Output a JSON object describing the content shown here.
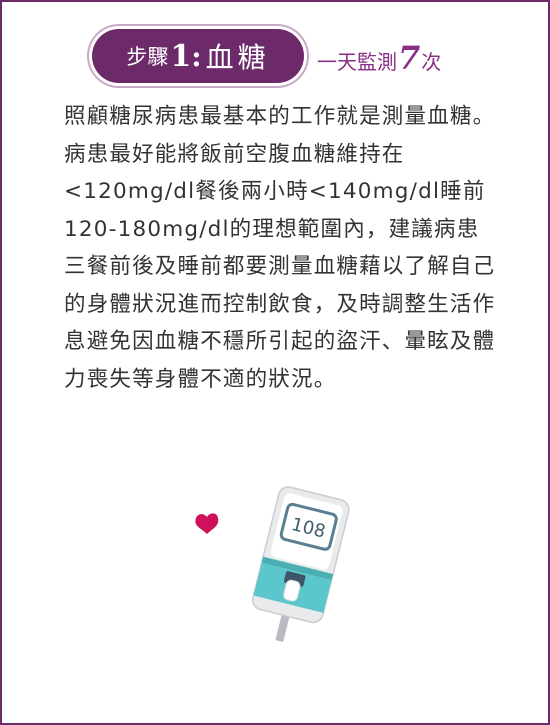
{
  "step": {
    "prefix": "步驟",
    "number": "1",
    "colon": ":",
    "title": "血糖"
  },
  "frequency": {
    "prefix": "一天監測",
    "count": "7",
    "suffix": "次"
  },
  "body": "照顧糖尿病患最基本的工作就是測量血糖。病患最好能將飯前空腹血糖維持在<120mg/dl餐後兩小時<140mg/dl睡前120-180mg/dl的理想範圍內，建議病患三餐前後及睡前都要測量血糖藉以了解自己的身體狀況進而控制飲食，及時調整生活作息避免因血糖不穩所引起的盜汗、暈眩及體力喪失等身體不適的狀況。",
  "meter": {
    "reading": "108"
  },
  "colors": {
    "frame": "#6c2a6b",
    "accent": "#8a2f87",
    "heart": "#d0105a",
    "meter_teal": "#5bc7cc"
  }
}
